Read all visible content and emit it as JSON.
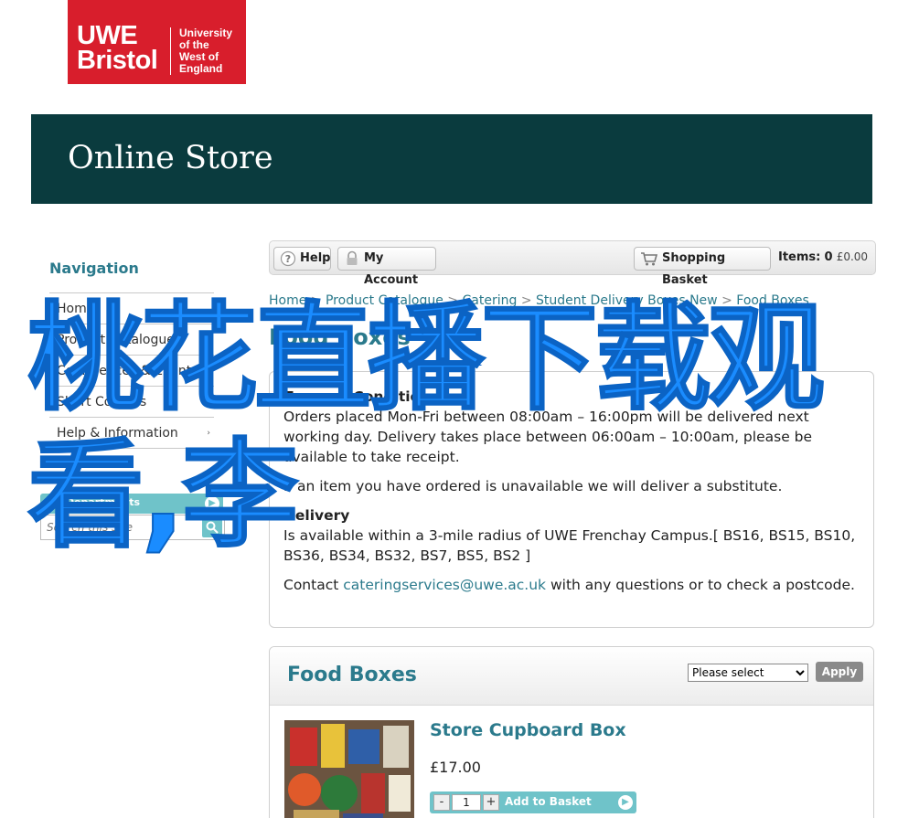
{
  "logo": {
    "line1": "UWE",
    "line2": "Bristol",
    "uni1": "University",
    "uni2": "of the",
    "uni3": "West of",
    "uni4": "England"
  },
  "banner": {
    "title": "Online Store"
  },
  "sidebar": {
    "heading": "Navigation",
    "items": [
      {
        "label": "Home",
        "arrow": ""
      },
      {
        "label": "Product Catalogue",
        "arrow": "›"
      },
      {
        "label": "Conferences & Events",
        "arrow": "›"
      },
      {
        "label": "Short Courses",
        "arrow": "›"
      },
      {
        "label": "Help & Information",
        "arrow": "›"
      }
    ],
    "departments": "All Departments",
    "search_placeholder": "Search this Site"
  },
  "toolbar": {
    "help": "Help",
    "account": "My Account",
    "basket": "Shopping Basket",
    "items_label": "Items:",
    "items_count": "0",
    "items_amount": "£0.00"
  },
  "breadcrumb": {
    "home": "Home",
    "catalogue": "Product Catalogue",
    "catering": "Catering",
    "delivery": "Student Delivery Boxes New",
    "current": "Food Boxes",
    "sep": ">"
  },
  "page_title": "Food Boxes",
  "terms": {
    "heading": "Terms & Conditions",
    "orders": "Orders placed Mon-Fri between 08:00am – 16:00pm will be delivered next working day. Delivery takes place between 06:00am – 10:00am, please be available to take receipt.",
    "substitute": "If an item you have ordered is unavailable we will deliver a substitute.",
    "delivery_heading": "Delivery",
    "delivery_text": "Is available within a 3-mile radius of UWE Frenchay Campus.[ BS16, BS15, BS10, BS36, BS34, BS32, BS7, BS5, BS2 ]",
    "contact_pre": "Contact",
    "contact_email": "cateringservices@uwe.ac.uk",
    "contact_post": "with any questions or to check a postcode."
  },
  "panel": {
    "title": "Food Boxes",
    "select_value": "Please select",
    "apply": "Apply"
  },
  "product": {
    "name": "Store Cupboard Box",
    "price": "£17.00",
    "qty": "1",
    "minus": "-",
    "plus": "+",
    "add_label": "Add to Basket"
  },
  "overlay": {
    "text": "桃花直播下载观看,李"
  },
  "colors": {
    "brand_red": "#d81e2c",
    "banner": "#0a3b3e",
    "accent_teal": "#2b7a8c",
    "overlay_blue": "#1a8cff"
  }
}
